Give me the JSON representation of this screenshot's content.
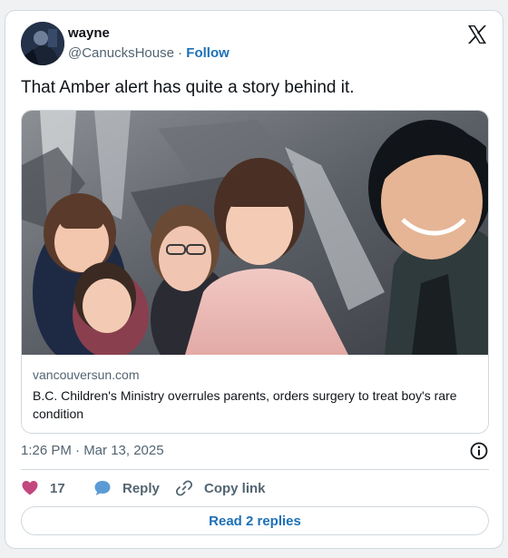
{
  "author": {
    "name": "wayne",
    "handle": "@CanucksHouse",
    "separator": "·",
    "follow_label": "Follow"
  },
  "tweet": {
    "text": "That Amber alert has quite a story behind it."
  },
  "link_card": {
    "domain": "vancouversun.com",
    "headline": "B.C. Children's Ministry overrules parents, orders surgery to treat boy's rare condition"
  },
  "timestamp": "1:26 PM · Mar 13, 2025",
  "actions": {
    "like_count": "17",
    "reply_label": "Reply",
    "copy_link_label": "Copy link"
  },
  "read_replies_label": "Read 2 replies",
  "colors": {
    "accent": "#1d70b8",
    "like": "#c2477e",
    "reply_bubble": "#5b9bd5",
    "muted_text": "#536471",
    "border": "#cfd9de"
  },
  "icons": [
    "x-logo-icon",
    "info-icon",
    "heart-icon",
    "reply-bubble-icon",
    "link-icon"
  ]
}
